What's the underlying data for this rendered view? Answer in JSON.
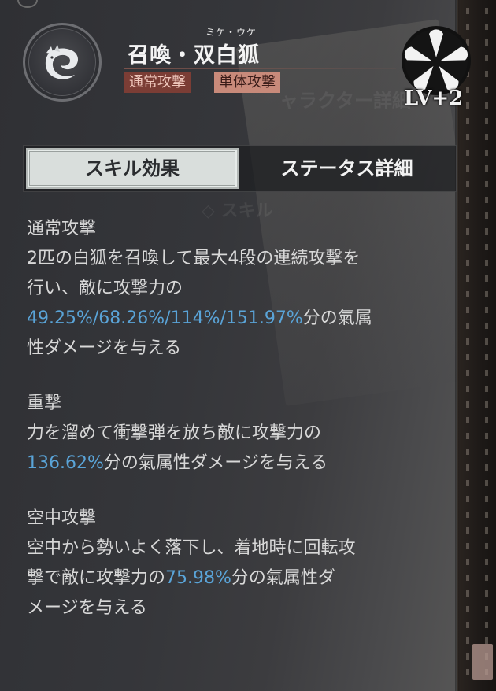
{
  "header": {
    "ruby": "ミケ・ウケ",
    "title": "召喚・双白狐",
    "tags": [
      "通常攻撃",
      "単体攻撃"
    ],
    "level": "LV+2",
    "emblem_icon": "white-fox-icon",
    "badge_icon": "five-petal-crest-icon"
  },
  "tabs": [
    {
      "label": "スキル効果",
      "active": true
    },
    {
      "label": "ステータス詳細",
      "active": false
    }
  ],
  "background_ghost_text": [
    "ャラクター詳細",
    "◇ スキル"
  ],
  "sections": [
    {
      "title": "通常攻撃",
      "lines": [
        [
          {
            "text": "2匹の白狐を召喚して最大4段の連続攻撃を"
          }
        ],
        [
          {
            "text": "行い、敵に攻撃力の"
          }
        ],
        [
          {
            "text": "49.25%/68.26%/114%/151.97%",
            "hl": true
          },
          {
            "text": "分の氣属"
          }
        ],
        [
          {
            "text": "性ダメージを与える"
          }
        ]
      ]
    },
    {
      "title": "重撃",
      "lines": [
        [
          {
            "text": "力を溜めて衝撃弾を放ち敵に攻撃力の"
          }
        ],
        [
          {
            "text": "136.62%",
            "hl": true
          },
          {
            "text": "分の氣属性ダメージを与える"
          }
        ]
      ]
    },
    {
      "title": "空中攻撃",
      "lines": [
        [
          {
            "text": "空中から勢いよく落下し、着地時に回転攻"
          }
        ],
        [
          {
            "text": "撃で敵に攻撃力の"
          },
          {
            "text": "75.98%",
            "hl": true
          },
          {
            "text": "分の氣属性ダ"
          }
        ],
        [
          {
            "text": "メージを与える"
          }
        ]
      ]
    }
  ],
  "colors": {
    "highlight": "#5aa4d8",
    "tag_primary": "#7b3d35",
    "tag_secondary": "#c88a7a",
    "tab_active": "#d9dedc"
  }
}
